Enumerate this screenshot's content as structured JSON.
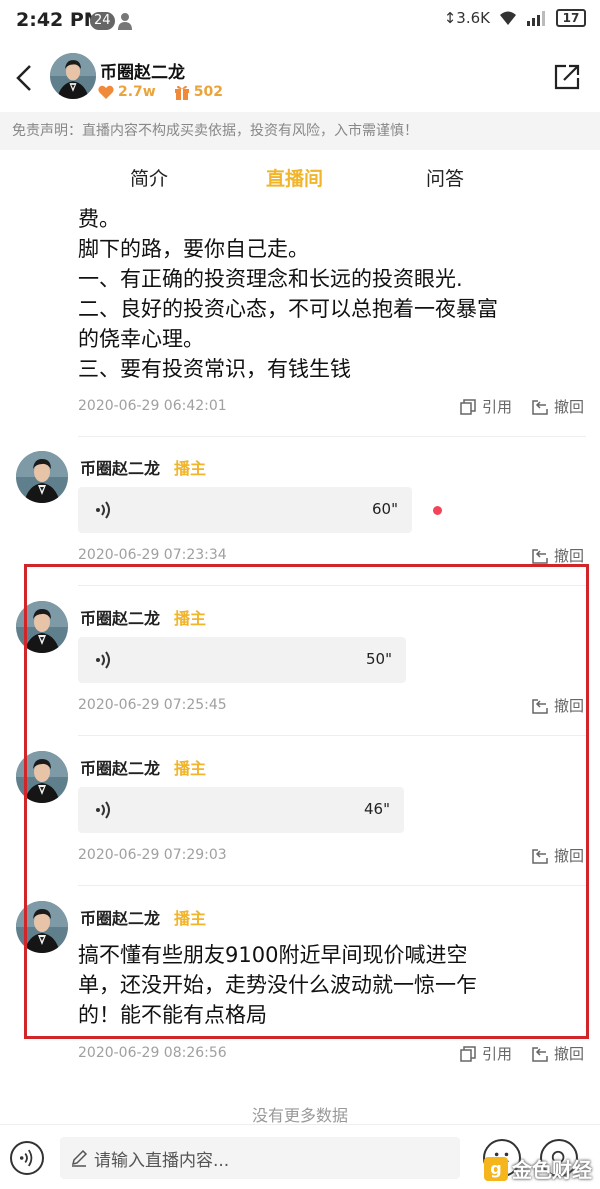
{
  "status_bar": {
    "time": "2:42 PM",
    "notification_count": "24",
    "net_speed": "3.6K",
    "battery": "17"
  },
  "header": {
    "anchor_name": "币圈赵二龙",
    "fans_count": "2.7w",
    "gift_count": "502"
  },
  "disclaimer": "免责声明：直播内容不构成买卖依据，投资有风险，入市需谨慎！",
  "tabs": [
    {
      "label": "简介",
      "active": false
    },
    {
      "label": "直播间",
      "active": true
    },
    {
      "label": "问答",
      "active": false
    }
  ],
  "feed": {
    "first_message": {
      "lines": [
        "费。",
        "脚下的路，要你自己走。",
        "一、有正确的投资理念和长远的投资眼光.",
        "二、良好的投资心态，不可以总抱着一夜暴富",
        "的侥幸心理。",
        "三、要有投资常识，有钱生钱"
      ],
      "timestamp": "2020-06-29 06:42:01",
      "quote_label": "引用",
      "withdraw_label": "撤回"
    },
    "messages": [
      {
        "name": "币圈赵二龙",
        "tag": "播主",
        "duration": "60\"",
        "timestamp": "2020-06-29 07:23:34",
        "withdraw_label": "撤回"
      },
      {
        "name": "币圈赵二龙",
        "tag": "播主",
        "duration": "50\"",
        "timestamp": "2020-06-29 07:25:45",
        "withdraw_label": "撤回"
      },
      {
        "name": "币圈赵二龙",
        "tag": "播主",
        "duration": "46\"",
        "timestamp": "2020-06-29 07:29:03",
        "withdraw_label": "撤回"
      }
    ],
    "last_message": {
      "name": "币圈赵二龙",
      "tag": "播主",
      "lines": [
        "搞不懂有些朋友9100附近早间现价喊进空",
        "单，还没开始，走势没什么波动就一惊一乍",
        "的！能不能有点格局"
      ],
      "timestamp": "2020-06-29 08:26:56",
      "quote_label": "引用",
      "withdraw_label": "撤回"
    },
    "no_more": "没有更多数据"
  },
  "input_bar": {
    "placeholder": "请输入直播内容..."
  },
  "watermark": {
    "text": "金色财经",
    "logo_char": "g"
  },
  "colors": {
    "accent": "#f1b52c",
    "highlight_border": "#d0262a",
    "unread_dot": "#f2455a"
  }
}
